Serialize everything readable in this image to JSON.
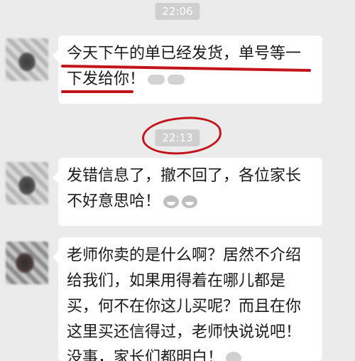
{
  "timestamps": [
    "22:06",
    "22:13"
  ],
  "messages": [
    {
      "lines": [
        "今天下午的单已经发货，单号等一",
        "下发给你！"
      ],
      "emojis": [
        "handshake-icon",
        "handshake-icon"
      ]
    },
    {
      "lines": [
        "发错信息了，撤不回了，各位家长",
        "不好意思哈！"
      ],
      "emojis": [
        "grin-icon",
        "grin-icon"
      ]
    },
    {
      "lines": [
        "老师你卖的是什么啊？居然不介绍",
        "给我们，如果用得着在哪儿都是",
        "买，何不在你这儿买呢？而且在你",
        "这里买还信得过，老师快说说吧！",
        "没事，家长们都明白！"
      ],
      "emojis": [
        "smile-icon"
      ]
    }
  ],
  "colors": {
    "background": "#ebebeb",
    "annotation_red": "#c4141b",
    "bubble": "#ffffff"
  }
}
